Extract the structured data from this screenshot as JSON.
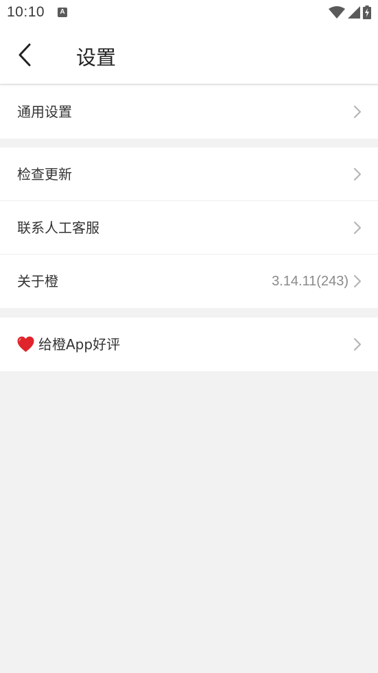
{
  "status_bar": {
    "time": "10:10",
    "notification_icon_letter": "A",
    "icons": [
      "wifi-icon",
      "signal-icon",
      "battery-charging-icon"
    ]
  },
  "header": {
    "back_icon": "chevron-left-icon",
    "title": "设置"
  },
  "sections": [
    {
      "rows": [
        {
          "label": "通用设置",
          "value": ""
        }
      ]
    },
    {
      "rows": [
        {
          "label": "检查更新",
          "value": ""
        },
        {
          "label": "联系人工客服",
          "value": ""
        },
        {
          "label": "关于橙",
          "value": "3.14.11(243)"
        }
      ]
    },
    {
      "rows": [
        {
          "label": "给橙App好评",
          "value": "",
          "icon": "heart-icon"
        }
      ]
    }
  ],
  "colors": {
    "background": "#f2f2f2",
    "surface": "#ffffff",
    "text": "#333333",
    "secondary_text": "#8a8a8a",
    "chevron": "#b5b5b5",
    "heart": "#e0242c"
  }
}
